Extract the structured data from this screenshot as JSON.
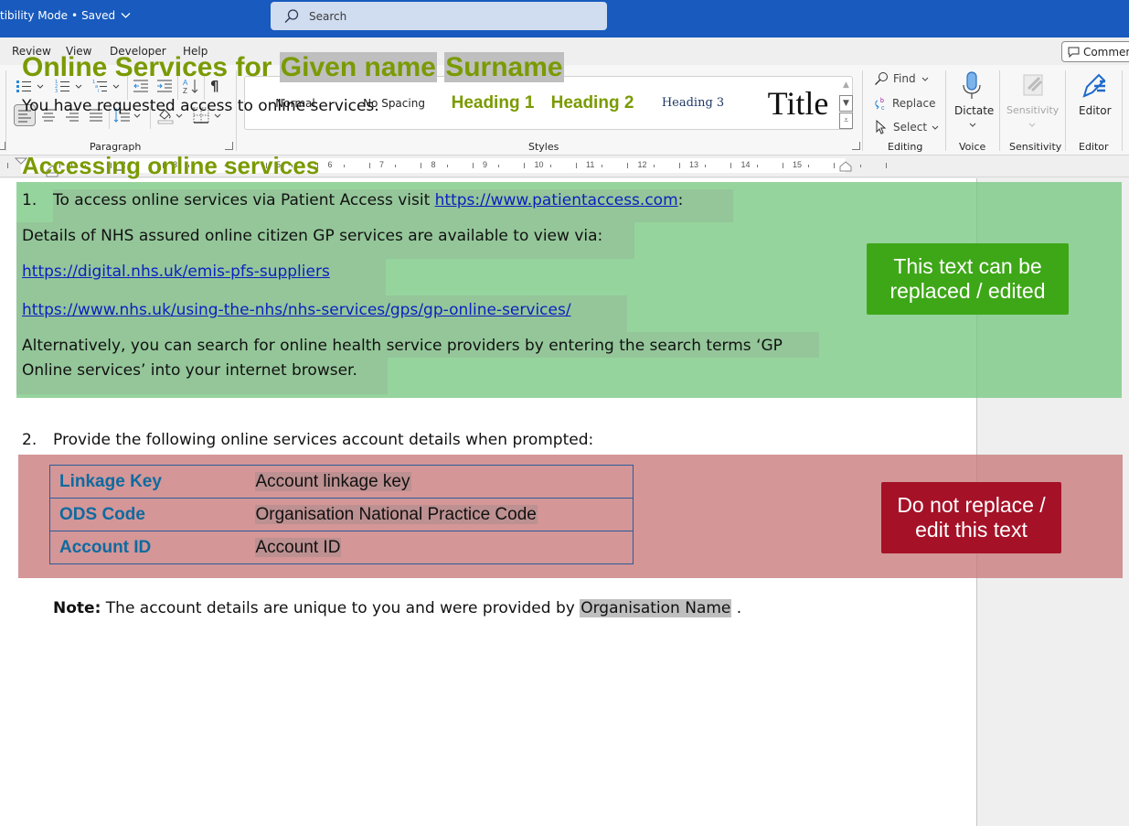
{
  "titlebar": {
    "doc_title": "tibility Mode",
    "separator": "•",
    "save_status": "Saved",
    "search_placeholder": "Search"
  },
  "tabs": [
    "Review",
    "View",
    "Developer",
    "Help"
  ],
  "comments_button": "Comments",
  "ribbon": {
    "groups": {
      "paragraph": "Paragraph",
      "styles": "Styles",
      "editing": "Editing",
      "voice": "Voice",
      "sensitivity": "Sensitivity",
      "editor": "Editor"
    },
    "styles": [
      "Normal",
      "No Spacing",
      "Heading 1",
      "Heading 2",
      "Heading 3",
      "Title"
    ],
    "editing": {
      "find": "Find",
      "replace": "Replace",
      "select": "Select"
    },
    "dictate": "Dictate",
    "sensitivity_btn": "Sensitivity",
    "editor_btn": "Editor"
  },
  "ruler": {
    "numbers": [
      "1",
      "2",
      "3",
      "4",
      "5",
      "6",
      "7",
      "8",
      "9",
      "10",
      "11",
      "12",
      "13",
      "14",
      "15"
    ]
  },
  "document": {
    "heading_prefix": "Online Services for",
    "given_name": "Given name",
    "surname": "Surname",
    "intro": "You have requested access to online services.",
    "section_heading": "Accessing online services",
    "step1_number": "1.",
    "step1_text": "To access online services via Patient Access visit",
    "step1_link": "https://www.patientaccess.com",
    "step1_suffix": ":",
    "details_text": "Details of NHS assured online citizen GP services are available to view via:",
    "link2": "https://digital.nhs.uk/emis-pfs-suppliers",
    "link3": "https://www.nhs.uk/using-the-nhs/nhs-services/gps/gp-online-services/",
    "alt_line1": "Alternatively, you can search for online health service providers by entering the search terms ‘GP",
    "alt_line2": "Online services’ into your internet browser.",
    "step2_number": "2.",
    "step2_text": "Provide the following online services account details when prompted:",
    "account_rows": [
      {
        "label": "Linkage Key",
        "value": "Account linkage key"
      },
      {
        "label": "ODS Code",
        "value": "Organisation National Practice Code"
      },
      {
        "label": "Account ID",
        "value": "Account ID"
      }
    ],
    "note_label": "Note:",
    "note_text": "The account details are unique to you and were provided by",
    "note_org": "Organisation Name",
    "note_end": "."
  },
  "callouts": {
    "editable": "This text can be replaced / edited",
    "locked": "Do not replace / edit this text"
  },
  "colors": {
    "titlebar": "#185abd",
    "heading_green": "#7a9a01",
    "editable_zone": "#95d3a3",
    "locked_zone": "#d49496",
    "callout_green": "#3ea718",
    "callout_red": "#a51127",
    "table_label": "#0e6aa0",
    "link": "#0b1fbf"
  }
}
